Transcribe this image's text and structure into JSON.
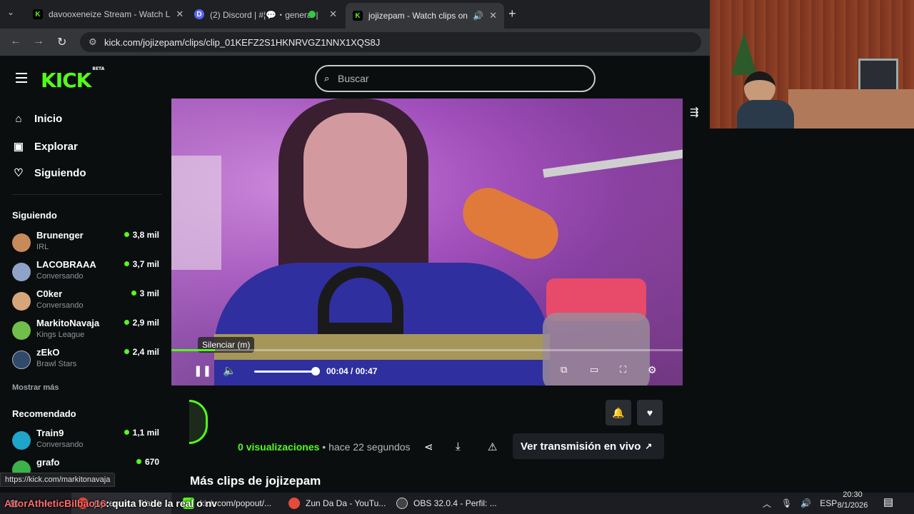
{
  "browser": {
    "tabs": [
      {
        "title": "davooxeneize Stream - Watch L",
        "favicon_color": "#53fc18",
        "favicon_letter": "K"
      },
      {
        "title": "(2) Discord | #¦💬・general |",
        "favicon_color": "#5865f2",
        "favicon_letter": "D"
      },
      {
        "title": "jojizepam - Watch clips on K",
        "favicon_color": "#53fc18",
        "favicon_letter": "K"
      }
    ],
    "new_tab": "+",
    "url": "kick.com/jojizepam/clips/clip_01KEFZ2S1HKNRVGZ1NNX1XQS8J"
  },
  "header": {
    "logo": "KICK",
    "logo_badge": "BETA",
    "search_placeholder": "Buscar"
  },
  "sidebar": {
    "nav": [
      {
        "label": "Inicio",
        "icon": "home-icon"
      },
      {
        "label": "Explorar",
        "icon": "browse-icon"
      },
      {
        "label": "Siguiendo",
        "icon": "heart-icon"
      }
    ],
    "following_heading": "Siguiendo",
    "following": [
      {
        "name": "Brunenger",
        "category": "IRL",
        "viewers": "3,8 mil",
        "avatar_color": "#c78a5a"
      },
      {
        "name": "LACOBRAAA",
        "category": "Conversando",
        "viewers": "3,7 mil",
        "avatar_color": "#8fa2c7"
      },
      {
        "name": "C0ker",
        "category": "Conversando",
        "viewers": "3 mil",
        "avatar_color": "#d6a57a"
      },
      {
        "name": "MarkitoNavaja",
        "category": "Kings League",
        "viewers": "2,9 mil",
        "avatar_color": "#6fbf4a"
      },
      {
        "name": "zEkO",
        "category": "Brawl Stars",
        "viewers": "2,4 mil",
        "avatar_color": "#2f4a6a"
      }
    ],
    "show_more": "Mostrar más",
    "recommended_heading": "Recomendado",
    "recommended": [
      {
        "name": "Train9",
        "category": "Conversando",
        "viewers": "1,1 mil",
        "avatar_color": "#1fa5c9"
      },
      {
        "name": "grafo",
        "category": "",
        "viewers": "670",
        "avatar_color": "#3bb24a"
      }
    ]
  },
  "player": {
    "tooltip": "Silenciar (m)",
    "time": "00:04 / 00:47",
    "progress": 0.085,
    "volume": 0.95
  },
  "clip": {
    "views_count": "0",
    "views_label": "visualizaciones",
    "separator": "•",
    "age": "hace 22 segundos",
    "live_button": "Ver transmisión en vivo",
    "more_clips": "Más clips de jojizepam"
  },
  "status_url": "https://kick.com/markitonavaja",
  "overlay_chat": {
    "user": "AitorAthleticBilbao16",
    "message": ": quita lo de la real o nv"
  },
  "taskbar": {
    "apps": [
      {
        "label": "jojizepam - Watch ...",
        "color": "#e64a3a"
      },
      {
        "label": "kick.com/popout/...",
        "color": "#53fc18"
      },
      {
        "label": "Zun Da Da - YouTu...",
        "color": "#e64a3a"
      },
      {
        "label": "OBS 32.0.4 - Perfil: ...",
        "color": "#444"
      }
    ],
    "lang": "ESP",
    "time": "20:30",
    "date": "8/1/2026"
  }
}
